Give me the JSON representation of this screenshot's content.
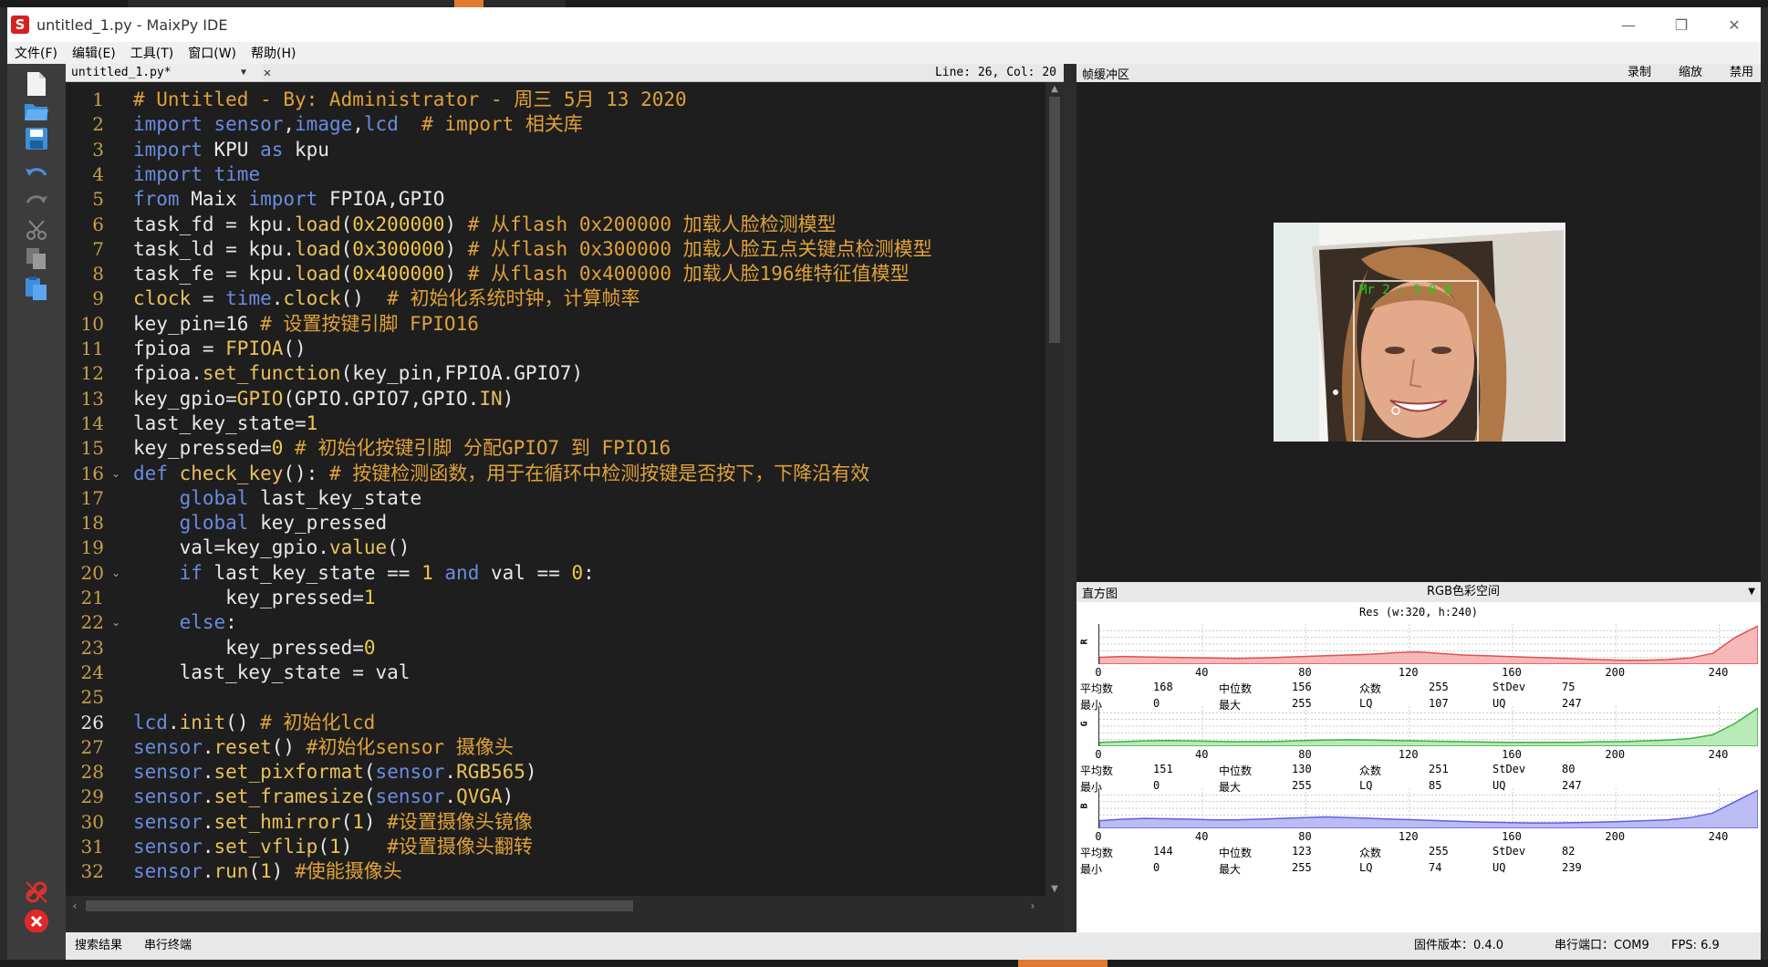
{
  "window": {
    "title": "untitled_1.py - MaixPy IDE",
    "logo": "S",
    "minimize": "—",
    "restore": "❐",
    "close": "✕"
  },
  "menu": [
    "文件(F)",
    "编辑(E)",
    "工具(T)",
    "窗口(W)",
    "帮助(H)"
  ],
  "editor": {
    "tab_label": "untitled_1.py*",
    "cursor_pos": "Line: 26, Col: 20"
  },
  "code_lines": [
    [
      [
        "c",
        "# Untitled - By: Administrator - 周三 5月 13 2020"
      ]
    ],
    [
      [
        "k",
        "import"
      ],
      [
        "v",
        " "
      ],
      [
        "k",
        "sensor"
      ],
      [
        "v",
        ","
      ],
      [
        "k",
        "image"
      ],
      [
        "v",
        ","
      ],
      [
        "k",
        "lcd"
      ],
      [
        "v",
        "  "
      ],
      [
        "c",
        "# import 相关库"
      ]
    ],
    [
      [
        "k",
        "import"
      ],
      [
        "v",
        " KPU "
      ],
      [
        "k",
        "as"
      ],
      [
        "v",
        " kpu"
      ]
    ],
    [
      [
        "k",
        "import"
      ],
      [
        "v",
        " "
      ],
      [
        "k",
        "time"
      ]
    ],
    [
      [
        "k",
        "from"
      ],
      [
        "v",
        " Maix "
      ],
      [
        "k",
        "import"
      ],
      [
        "v",
        " FPIOA,GPIO"
      ]
    ],
    [
      [
        "v",
        "task_fd = kpu."
      ],
      [
        "f",
        "load"
      ],
      [
        "v",
        "("
      ],
      [
        "n",
        "0x200000"
      ],
      [
        "v",
        ") "
      ],
      [
        "c",
        "# 从flash 0x200000 加载人脸检测模型"
      ]
    ],
    [
      [
        "v",
        "task_ld = kpu."
      ],
      [
        "f",
        "load"
      ],
      [
        "v",
        "("
      ],
      [
        "n",
        "0x300000"
      ],
      [
        "v",
        ") "
      ],
      [
        "c",
        "# 从flash 0x300000 加载人脸五点关键点检测模型"
      ]
    ],
    [
      [
        "v",
        "task_fe = kpu."
      ],
      [
        "f",
        "load"
      ],
      [
        "v",
        "("
      ],
      [
        "n",
        "0x400000"
      ],
      [
        "v",
        ") "
      ],
      [
        "c",
        "# 从flash 0x400000 加载人脸196维特征值模型"
      ]
    ],
    [
      [
        "f",
        "clock"
      ],
      [
        "v",
        " = "
      ],
      [
        "k",
        "time"
      ],
      [
        "v",
        "."
      ],
      [
        "f",
        "clock"
      ],
      [
        "v",
        "()  "
      ],
      [
        "c",
        "# 初始化系统时钟，计算帧率"
      ]
    ],
    [
      [
        "v",
        "key_pin=16 "
      ],
      [
        "c",
        "# 设置按键引脚 FPIO16"
      ]
    ],
    [
      [
        "v",
        "fpioa = "
      ],
      [
        "f",
        "FPIOA"
      ],
      [
        "v",
        "()"
      ]
    ],
    [
      [
        "v",
        "fpioa."
      ],
      [
        "f",
        "set_function"
      ],
      [
        "v",
        "(key_pin,FPIOA.GPIO7)"
      ]
    ],
    [
      [
        "v",
        "key_gpio="
      ],
      [
        "f",
        "GPIO"
      ],
      [
        "v",
        "(GPIO.GPIO7,GPIO."
      ],
      [
        "f",
        "IN"
      ],
      [
        "v",
        ")"
      ]
    ],
    [
      [
        "v",
        "last_key_state="
      ],
      [
        "n",
        "1"
      ]
    ],
    [
      [
        "v",
        "key_pressed="
      ],
      [
        "n",
        "0"
      ],
      [
        "v",
        " "
      ],
      [
        "c",
        "# 初始化按键引脚 分配GPIO7 到 FPIO16"
      ]
    ],
    [
      [
        "k",
        "def"
      ],
      [
        "v",
        " "
      ],
      [
        "f",
        "check_key"
      ],
      [
        "v",
        "(): "
      ],
      [
        "c",
        "# 按键检测函数，用于在循环中检测按键是否按下，下降沿有效"
      ]
    ],
    [
      [
        "v",
        "    "
      ],
      [
        "k",
        "global"
      ],
      [
        "v",
        " last_key_state"
      ]
    ],
    [
      [
        "v",
        "    "
      ],
      [
        "k",
        "global"
      ],
      [
        "v",
        " key_pressed"
      ]
    ],
    [
      [
        "v",
        "    val=key_gpio."
      ],
      [
        "f",
        "value"
      ],
      [
        "v",
        "()"
      ]
    ],
    [
      [
        "v",
        "    "
      ],
      [
        "k",
        "if"
      ],
      [
        "v",
        " last_key_state == "
      ],
      [
        "n",
        "1"
      ],
      [
        "v",
        " "
      ],
      [
        "k",
        "and"
      ],
      [
        "v",
        " val == "
      ],
      [
        "n",
        "0"
      ],
      [
        "v",
        ":"
      ]
    ],
    [
      [
        "v",
        "        key_pressed="
      ],
      [
        "n",
        "1"
      ]
    ],
    [
      [
        "v",
        "    "
      ],
      [
        "k",
        "else"
      ],
      [
        "v",
        ":"
      ]
    ],
    [
      [
        "v",
        "        key_pressed="
      ],
      [
        "n",
        "0"
      ]
    ],
    [
      [
        "v",
        "    last_key_state = val"
      ]
    ],
    [
      [
        "v",
        ""
      ]
    ],
    [
      [
        "k",
        "lcd"
      ],
      [
        "v",
        "."
      ],
      [
        "f",
        "init"
      ],
      [
        "v",
        "() "
      ],
      [
        "c",
        "# 初始化lcd"
      ]
    ],
    [
      [
        "k",
        "sensor"
      ],
      [
        "v",
        "."
      ],
      [
        "f",
        "reset"
      ],
      [
        "v",
        "() "
      ],
      [
        "c",
        "#初始化sensor 摄像头"
      ]
    ],
    [
      [
        "k",
        "sensor"
      ],
      [
        "v",
        "."
      ],
      [
        "f",
        "set_pixformat"
      ],
      [
        "v",
        "("
      ],
      [
        "k",
        "sensor"
      ],
      [
        "v",
        "."
      ],
      [
        "f",
        "RGB565"
      ],
      [
        "v",
        ")"
      ]
    ],
    [
      [
        "k",
        "sensor"
      ],
      [
        "v",
        "."
      ],
      [
        "f",
        "set_framesize"
      ],
      [
        "v",
        "("
      ],
      [
        "k",
        "sensor"
      ],
      [
        "v",
        "."
      ],
      [
        "f",
        "QVGA"
      ],
      [
        "v",
        ")"
      ]
    ],
    [
      [
        "k",
        "sensor"
      ],
      [
        "v",
        "."
      ],
      [
        "f",
        "set_hmirror"
      ],
      [
        "v",
        "("
      ],
      [
        "n",
        "1"
      ],
      [
        "v",
        ") "
      ],
      [
        "c",
        "#设置摄像头镜像"
      ]
    ],
    [
      [
        "k",
        "sensor"
      ],
      [
        "v",
        "."
      ],
      [
        "f",
        "set_vflip"
      ],
      [
        "v",
        "("
      ],
      [
        "n",
        "1"
      ],
      [
        "v",
        ")   "
      ],
      [
        "c",
        "#设置摄像头翻转"
      ]
    ],
    [
      [
        "k",
        "sensor"
      ],
      [
        "v",
        "."
      ],
      [
        "f",
        "run"
      ],
      [
        "v",
        "("
      ],
      [
        "n",
        "1"
      ],
      [
        "v",
        ") "
      ],
      [
        "c",
        "#使能摄像头"
      ]
    ]
  ],
  "line_numbers": [
    "1",
    "2",
    "3",
    "4",
    "5",
    "6",
    "7",
    "8",
    "9",
    "10",
    "11",
    "12",
    "13",
    "14",
    "15",
    "16",
    "17",
    "18",
    "19",
    "20",
    "21",
    "22",
    "23",
    "24",
    "25",
    "26",
    "27",
    "28",
    "29",
    "30",
    "31",
    "32"
  ],
  "current_line": 26,
  "fold_lines": [
    16,
    20,
    22
  ],
  "framebuffer": {
    "title": "帧缓冲区",
    "record": "录制",
    "zoom": "缩放",
    "disable": "禁用",
    "overlay_text": "Mr 2 : 9 0 8"
  },
  "histogram": {
    "title": "直方图",
    "mode": "RGB色彩空间",
    "resolution": "Res (w:320, h:240)",
    "ticks": [
      "0",
      "40",
      "80",
      "120",
      "160",
      "200",
      "240"
    ],
    "labels": {
      "mean": "平均数",
      "median": "中位数",
      "mode": "众数",
      "stdev": "StDev",
      "min": "最小",
      "max": "最大",
      "lq": "LQ",
      "uq": "UQ"
    },
    "channels": [
      {
        "name": "R",
        "color": "#e05050",
        "fill": "#f6b8b8",
        "mean": "168",
        "median": "156",
        "mode": "255",
        "stdev": "75",
        "min": "0",
        "max": "255",
        "lq": "107",
        "uq": "247"
      },
      {
        "name": "G",
        "color": "#40b040",
        "fill": "#b8eab8",
        "mean": "151",
        "median": "130",
        "mode": "251",
        "stdev": "80",
        "min": "0",
        "max": "255",
        "lq": "85",
        "uq": "247"
      },
      {
        "name": "B",
        "color": "#6060e0",
        "fill": "#bcbcf4",
        "mean": "144",
        "median": "123",
        "mode": "255",
        "stdev": "82",
        "min": "0",
        "max": "255",
        "lq": "74",
        "uq": "239"
      }
    ]
  },
  "statusbar": {
    "search_results": "搜索结果",
    "serial_terminal": "串行终端",
    "firmware": "固件版本：0.4.0",
    "serial_port": "串行端口：COM9",
    "fps": "FPS:   6.9"
  },
  "colors": {
    "accent": "#e07a30",
    "editor_bg": "#1e1e1e"
  }
}
